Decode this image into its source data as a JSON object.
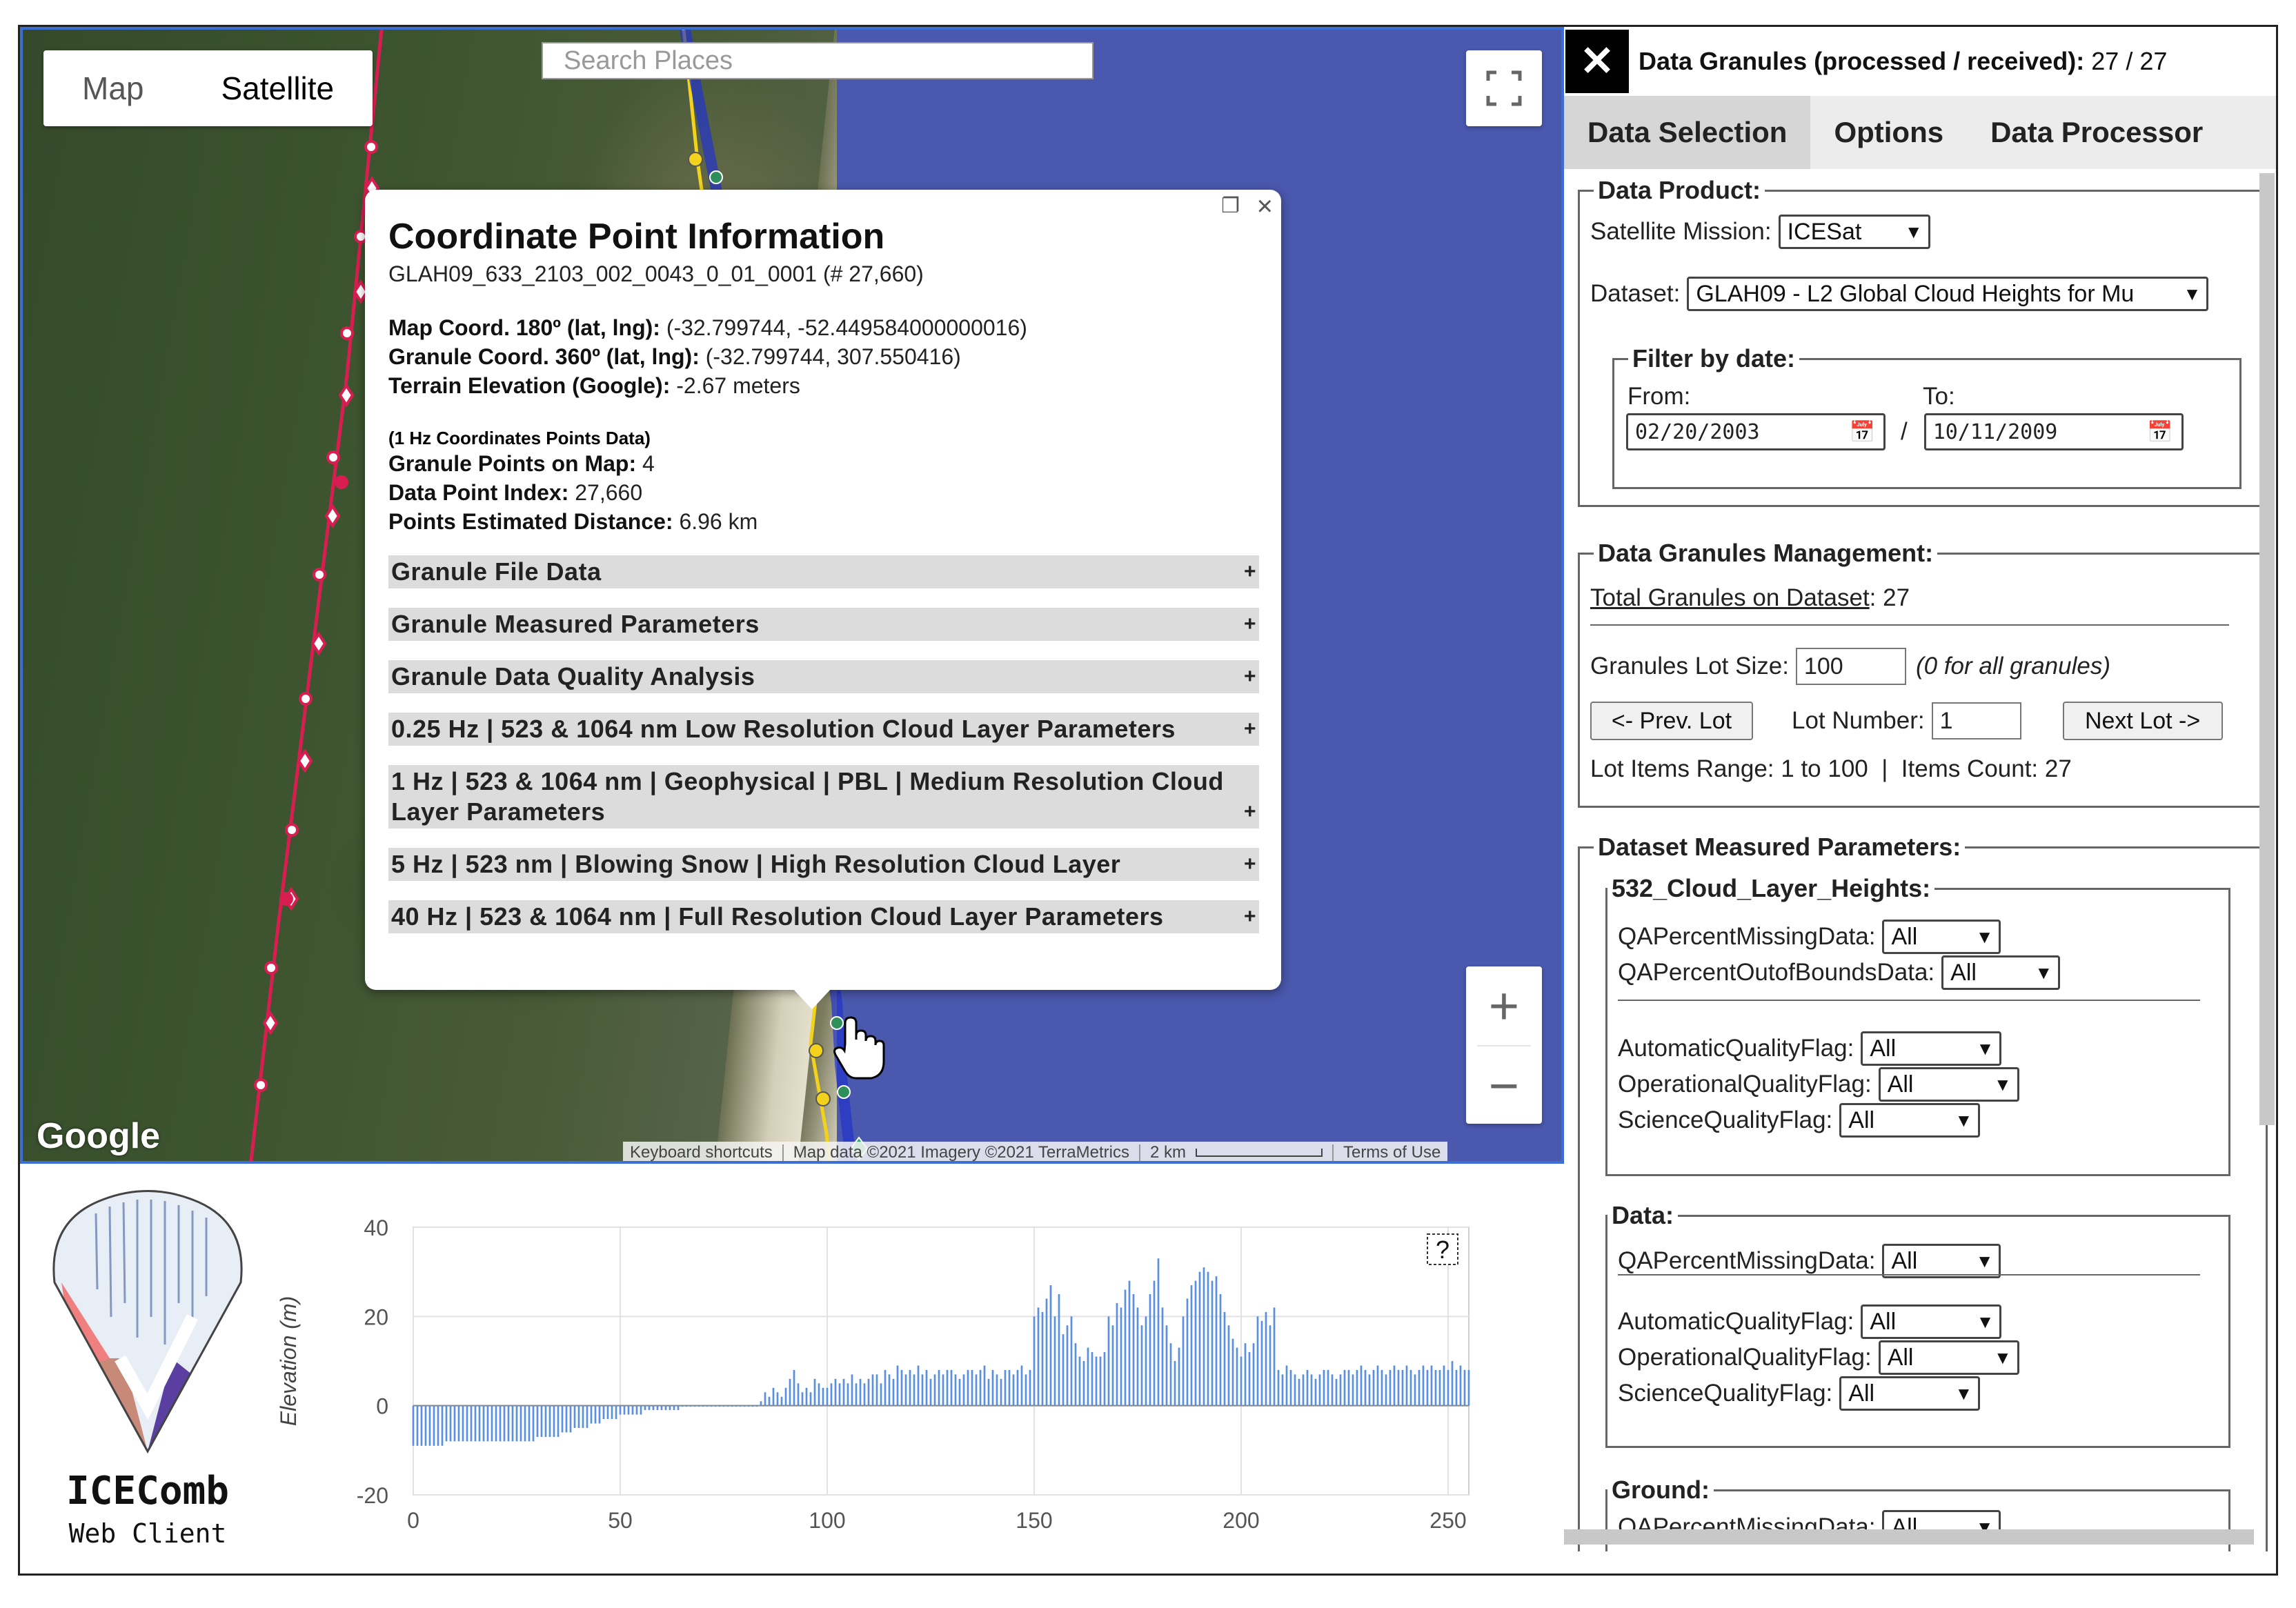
{
  "map": {
    "map_types": [
      "Map",
      "Satellite"
    ],
    "active_map_type": "Satellite",
    "search_placeholder": "Search Places",
    "zoom_in": "+",
    "zoom_out": "−",
    "google_logo": "Google",
    "attribution": {
      "shortcuts": "Keyboard shortcuts",
      "map_data": "Map data ©2021 Imagery ©2021 TerraMetrics",
      "scale": "2 km",
      "terms": "Terms of Use"
    }
  },
  "popup": {
    "title": "Coordinate Point Information",
    "granule_id": "GLAH09_633_2103_002_0043_0_01_0001 (# 27,660)",
    "map_coord_label": "Map Coord. 180º (lat, lng):",
    "map_coord_value": "(-32.799744, -52.449584000000016)",
    "granule_coord_label": "Granule Coord. 360º (lat, lng):",
    "granule_coord_value": "(-32.799744, 307.550416)",
    "terrain_label": "Terrain Elevation (Google):",
    "terrain_value": "-2.67 meters",
    "coord_points_note": "(1 Hz Coordinates Points Data)",
    "granule_points_label": "Granule Points on Map:",
    "granule_points_value": "4",
    "data_point_index_label": "Data Point Index:",
    "data_point_index_value": "27,660",
    "points_distance_label": "Points Estimated Distance:",
    "points_distance_value": "6.96 km",
    "sections": [
      "Granule File Data",
      "Granule Measured Parameters",
      "Granule Data Quality Analysis",
      "0.25 Hz | 523 & 1064 nm Low Resolution Cloud Layer Parameters",
      "1 Hz | 523 & 1064 nm | Geophysical | PBL | Medium Resolution Cloud Layer Parameters",
      "5 Hz | 523 nm | Blowing Snow | High Resolution Cloud Layer",
      "40 Hz | 523 & 1064 nm | Full Resolution Cloud Layer Parameters"
    ],
    "expand_symbol": "+"
  },
  "panel": {
    "close_symbol": "✕",
    "granules_label": "Data Granules (processed / received):",
    "granules_value": "27 / 27",
    "tabs": [
      "Data Selection",
      "Options",
      "Data Processor"
    ],
    "active_tab": "Data Selection",
    "data_product": {
      "legend": "Data Product:",
      "mission_label": "Satellite Mission:",
      "mission_value": "ICESat",
      "dataset_label": "Dataset:",
      "dataset_value": "GLAH09 - L2 Global Cloud Heights for Mu",
      "filter_legend": "Filter by date:",
      "from_label": "From:",
      "to_label": "To:",
      "from_value": "02/20/2003",
      "to_value": "10/11/2009",
      "date_sep": "/"
    },
    "granules_mgmt": {
      "legend": "Data Granules Management:",
      "total_label": "Total Granules on Dataset",
      "total_value": ": 27",
      "lot_size_label": "Granules Lot Size:",
      "lot_size_value": "100",
      "lot_size_hint": "(0 for all granules)",
      "prev_button": "<- Prev. Lot",
      "lot_number_label": "Lot Number:",
      "lot_number_value": "1",
      "next_button": "Next Lot ->",
      "range_text": "Lot Items Range: 1 to 100  |  Items Count: 27"
    },
    "measured": {
      "legend": "Dataset Measured Parameters:",
      "groups": [
        {
          "legend": "532_Cloud_Layer_Heights:",
          "fields": [
            {
              "label": "QAPercentMissingData:",
              "value": "All"
            },
            {
              "label": "QAPercentOutofBoundsData:",
              "value": "All"
            },
            {
              "label": "AutomaticQualityFlag:",
              "value": "All"
            },
            {
              "label": "OperationalQualityFlag:",
              "value": "All"
            },
            {
              "label": "ScienceQualityFlag:",
              "value": "All"
            }
          ]
        },
        {
          "legend": "Data:",
          "fields": [
            {
              "label": "QAPercentMissingData:",
              "value": "All"
            },
            {
              "label": "AutomaticQualityFlag:",
              "value": "All"
            },
            {
              "label": "OperationalQualityFlag:",
              "value": "All"
            },
            {
              "label": "ScienceQualityFlag:",
              "value": "All"
            }
          ]
        },
        {
          "legend": "Ground:",
          "fields": [
            {
              "label": "QAPercentMissingData:",
              "value": "All"
            }
          ]
        }
      ]
    }
  },
  "logo": {
    "name": "ICEComb",
    "subtitle": "Web Client"
  },
  "chart_data": {
    "type": "bar",
    "ylabel": "Elevation (m)",
    "xlabel": "",
    "xlim": [
      0,
      255
    ],
    "ylim": [
      -20,
      40
    ],
    "xticks": [
      0,
      50,
      100,
      150,
      200,
      250
    ],
    "yticks": [
      -20,
      0,
      20,
      40
    ],
    "help_symbol": "?",
    "bar_color": "#5b8fd9",
    "x_start": 0,
    "x_step": 1,
    "values": [
      -9,
      -9,
      -9,
      -9,
      -9,
      -9,
      -9,
      -9,
      -8,
      -8,
      -8,
      -8,
      -8,
      -8,
      -8,
      -8,
      -8,
      -8,
      -8,
      -8,
      -8,
      -8,
      -8,
      -8,
      -8,
      -8,
      -8,
      -8,
      -8,
      -8,
      -7,
      -7,
      -7,
      -7,
      -7,
      -7,
      -6,
      -6,
      -6,
      -5,
      -5,
      -5,
      -5,
      -4,
      -4,
      -4,
      -3,
      -3,
      -3,
      -3,
      -2,
      -2,
      -2,
      -2,
      -2,
      -2,
      -1,
      -1,
      -1,
      -1,
      -1,
      -1,
      -1,
      -1,
      -1,
      0,
      0,
      0,
      0,
      0,
      0,
      0,
      0,
      0,
      0,
      0,
      0,
      0,
      0,
      0,
      0,
      0,
      0,
      0,
      1,
      3,
      2,
      4,
      3,
      2,
      4,
      6,
      8,
      5,
      3,
      4,
      3,
      6,
      5,
      4,
      4,
      5,
      6,
      5,
      6,
      5,
      7,
      5,
      6,
      5,
      6,
      7,
      7,
      5,
      8,
      7,
      6,
      9,
      8,
      7,
      8,
      7,
      9,
      7,
      8,
      6,
      7,
      8,
      7,
      8,
      8,
      7,
      6,
      7,
      8,
      8,
      7,
      8,
      9,
      6,
      8,
      7,
      6,
      8,
      8,
      7,
      8,
      9,
      7,
      8,
      20,
      22,
      21,
      24,
      27,
      20,
      25,
      16,
      18,
      20,
      14,
      11,
      10,
      13,
      12,
      11,
      11,
      12,
      20,
      18,
      23,
      22,
      26,
      28,
      25,
      22,
      18,
      20,
      25,
      28,
      33,
      22,
      18,
      14,
      10,
      13,
      20,
      24,
      27,
      28,
      30,
      31,
      30,
      28,
      29,
      25,
      21,
      18,
      15,
      13,
      11,
      14,
      12,
      14,
      20,
      19,
      21,
      18,
      22,
      8,
      7,
      9,
      8,
      7,
      6,
      7,
      8,
      7,
      6,
      7,
      8,
      8,
      7,
      6,
      7,
      8,
      8,
      7,
      8,
      9,
      8,
      7,
      8,
      9,
      8,
      7,
      8,
      9,
      8,
      8,
      9,
      8,
      7,
      8,
      9,
      8,
      9,
      8,
      8,
      9,
      8,
      10,
      8,
      9,
      8,
      8
    ]
  }
}
